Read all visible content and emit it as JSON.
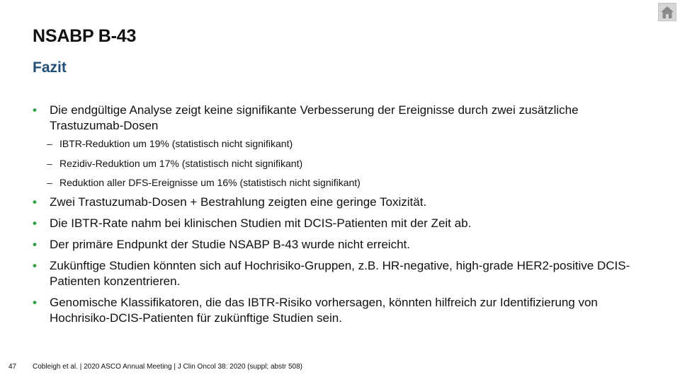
{
  "header": {
    "title": "NSABP B-43",
    "subtitle": "Fazit",
    "home_icon": "home-icon"
  },
  "bullets": [
    {
      "text": "Die endgültige Analyse zeigt keine signifikante Verbesserung der Ereignisse durch zwei zusätzliche Trastuzumab-Dosen",
      "subitems": [
        "IBTR-Reduktion um 19% (statistisch nicht signifikant)",
        "Rezidiv-Reduktion um 17% (statistisch nicht signifikant)",
        "Reduktion aller DFS-Ereignisse um 16% (statistisch nicht signifikant)"
      ]
    },
    {
      "text": "Zwei Trastuzumab-Dosen + Bestrahlung zeigten eine geringe Toxizität."
    },
    {
      "text": "Die IBTR-Rate nahm bei klinischen Studien mit DCIS-Patienten mit der Zeit ab."
    },
    {
      "text": "Der primäre Endpunkt der Studie NSABP B-43 wurde nicht erreicht."
    },
    {
      "text": "Zukünftige Studien könnten sich auf Hochrisiko-Gruppen, z.B. HR-negative, high-grade HER2-positive DCIS-Patienten konzentrieren."
    },
    {
      "text": "Genomische Klassifikatoren, die das IBTR-Risiko vorhersagen, könnten hilfreich zur Identifizierung von Hochrisiko-DCIS-Patienten für zukünftige Studien sein."
    }
  ],
  "bullet_marker": "•",
  "sub_marker": "–",
  "footer": {
    "page_number": "47",
    "citation": "Cobleigh et al. | 2020 ASCO Annual Meeting | J Clin Oncol 38: 2020 (suppl; abstr 508)"
  },
  "colors": {
    "title": "#111111",
    "subtitle": "#1f4e79",
    "bullet": "#2f9e44",
    "home_button_bg": "#d6d6d6",
    "home_icon": "#8a8a8a"
  }
}
